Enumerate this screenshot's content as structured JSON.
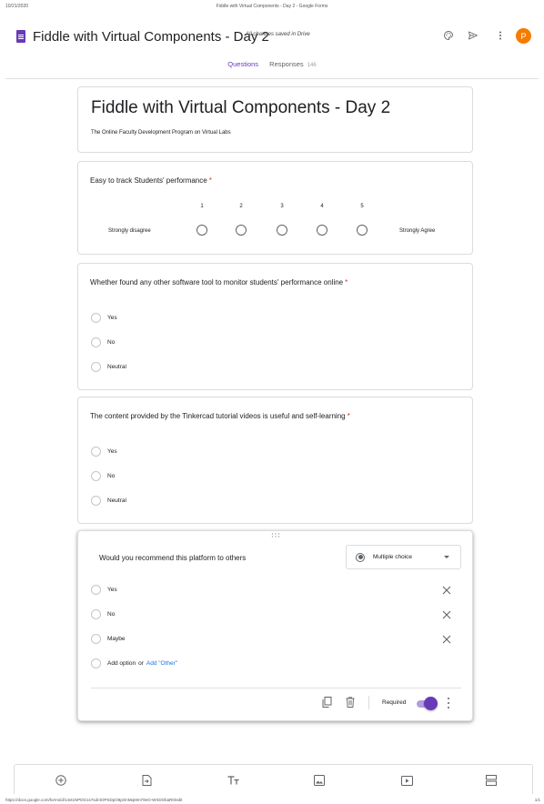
{
  "print": {
    "date": "10/21/2020",
    "page_title": "Fiddle with Virtual Components - Day 2 - Google Forms",
    "url": "https://docs.google.com/forms/d/14vt1NPDG1s7sdr4OPSDpO8pOnMqMm79eO-WXDObaR0/edit",
    "page_number": "1/1"
  },
  "appbar": {
    "doc_title": "Fiddle with Virtual Components - Day 2",
    "saved_status": "All changes saved in Drive",
    "avatar_initial": "P",
    "brand_color": "#673ab7",
    "avatar_color": "#f57c00"
  },
  "tabs": {
    "questions": "Questions",
    "responses": "Responses",
    "responses_count": "146"
  },
  "form": {
    "title": "Fiddle with Virtual Components - Day 2",
    "description": "The Online Faculty Development Program on Virtual Labs"
  },
  "q1": {
    "text": "Easy to track Students' performance",
    "required_mark": "*",
    "scale": [
      "1",
      "2",
      "3",
      "4",
      "5"
    ],
    "low_label": "Strongly disagree",
    "high_label": "Strongly Agree"
  },
  "q2": {
    "text": "Whether found any other software tool to monitor students' performance online",
    "required_mark": "*",
    "options": [
      "Yes",
      "No",
      "Neutral"
    ]
  },
  "q3": {
    "text": "The content provided by the Tinkercad tutorial videos is useful and self-learning",
    "required_mark": "*",
    "options": [
      "Yes",
      "No",
      "Neutral"
    ]
  },
  "q4": {
    "text": "Would you recommend this platform to others",
    "type": "Multiple choice",
    "options": [
      "Yes",
      "No",
      "Maybe"
    ],
    "add_option": "Add option",
    "or": "or",
    "add_other": "Add \"Other\"",
    "required_label": "Required",
    "required_on": true
  }
}
